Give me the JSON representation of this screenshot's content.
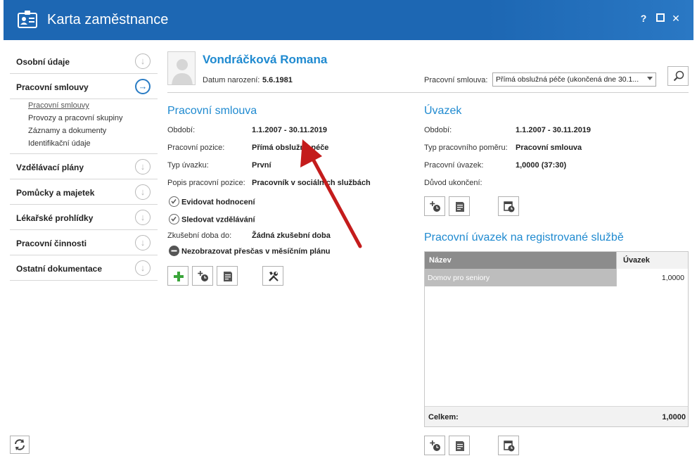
{
  "window": {
    "title": "Karta zaměstnance",
    "help": "?",
    "maximize": "▭",
    "close": "✕",
    "accent": "#1d67b3"
  },
  "nav": {
    "items": [
      {
        "label": "Osobní údaje",
        "icon": "arrow-down-circle-icon"
      },
      {
        "label": "Pracovní smlouvy",
        "icon": "arrow-right-circle-icon",
        "active": true
      },
      {
        "label": "Vzdělávací plány",
        "icon": "arrow-down-circle-icon"
      },
      {
        "label": "Pomůcky a majetek",
        "icon": "arrow-down-circle-icon"
      },
      {
        "label": "Lékařské prohlídky",
        "icon": "arrow-down-circle-icon"
      },
      {
        "label": "Pracovní činnosti",
        "icon": "arrow-down-circle-icon"
      },
      {
        "label": "Ostatní dokumentace",
        "icon": "arrow-down-circle-icon"
      }
    ],
    "subitems": [
      "Pracovní smlouvy",
      "Provozy a pracovní skupiny",
      "Záznamy a dokumenty",
      "Identifikační údaje"
    ]
  },
  "header": {
    "name": "Vondráčková Romana",
    "birth_label": "Datum narození:",
    "birth_value": "5.6.1981",
    "contract_label": "Pracovní smlouva:",
    "contract_value": "Přímá obslužná péče (ukončená dne 30.1..."
  },
  "contract": {
    "title": "Pracovní smlouva",
    "fields": [
      {
        "label": "Období:",
        "value": "1.1.2007 - 30.11.2019"
      },
      {
        "label": "Pracovní pozice:",
        "value": "Přímá obslužná péče"
      },
      {
        "label": "Typ úvazku:",
        "value": "První"
      },
      {
        "label": "Popis pracovní pozice:",
        "value": "Pracovník v sociálních službách"
      }
    ],
    "check1": "Evidovat hodnocení",
    "check2": "Sledovat vzdělávání",
    "trial_label": "Zkušební doba do:",
    "trial_value": "Žádná zkušební doba",
    "check3": "Nezobrazovat přesčas v měsíčním plánu"
  },
  "workload": {
    "title": "Úvazek",
    "fields": [
      {
        "label": "Období:",
        "value": "1.1.2007 - 30.11.2019"
      },
      {
        "label": "Typ pracovního poměru:",
        "value": "Pracovní smlouva"
      },
      {
        "label": "Pracovní úvazek:",
        "value": "1,0000 (37:30)"
      },
      {
        "label": "Důvod ukončení:",
        "value": ""
      }
    ]
  },
  "services": {
    "title": "Pracovní úvazek na registrované službě",
    "col_name": "Název",
    "col_load": "Úvazek",
    "rows": [
      {
        "name": "Domov pro seniory",
        "load": "1,0000"
      }
    ],
    "total_label": "Celkem:",
    "total_value": "1,0000"
  }
}
